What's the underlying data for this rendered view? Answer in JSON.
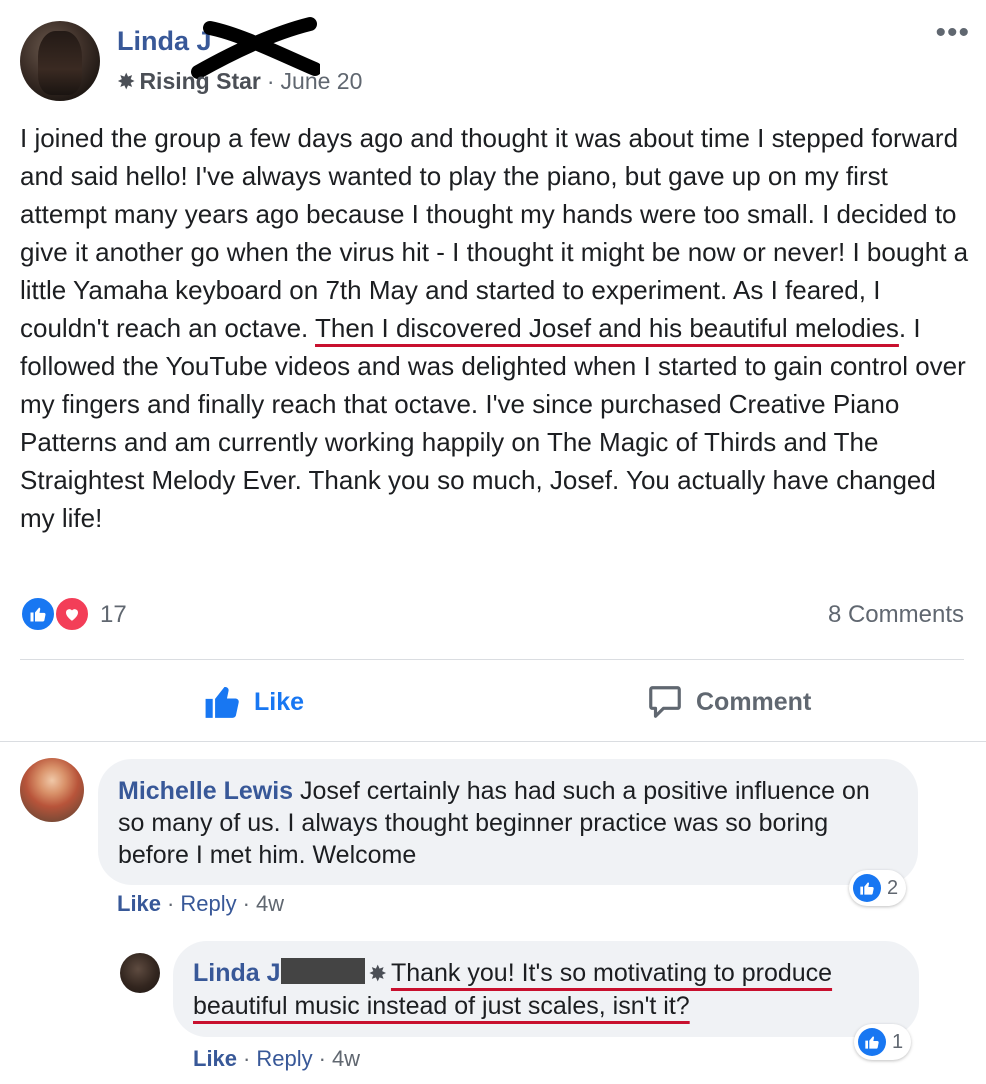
{
  "post": {
    "author": "Linda J",
    "badge": "Rising Star",
    "date": "June 20",
    "more_label": "•••",
    "body_before": "I joined the group a few days ago and thought it was about time I stepped forward and said hello! I've always wanted to play the piano, but gave up on my first attempt many years ago because I thought my hands were too small. I decided to give it another go when the virus hit - I thought it might be now or never! I bought a little Yamaha keyboard on 7th May and started to experiment. As I feared, I couldn't reach an octave. ",
    "body_highlight": "Then I discovered Josef and his beautiful melodies",
    "body_after": ". I followed the YouTube videos and was delighted when I started to gain control over my fingers and finally reach that octave. I've since purchased Creative Piano Patterns and am currently working happily on The Magic of Thirds and The Straightest Melody Ever. Thank you so much, Josef. You actually have changed my life!",
    "reaction_count": "17",
    "comments_count": "8 Comments"
  },
  "actions": {
    "like_label": "Like",
    "comment_label": "Comment"
  },
  "comments": [
    {
      "name": "Michelle Lewis",
      "text": "Josef certainly has had such a positive influence on so many of us. I always thought beginner practice was so boring before I met him. Welcome",
      "like_label": "Like",
      "reply_label": "Reply",
      "age": "4w",
      "reactions": "2"
    },
    {
      "name": "Linda J",
      "text_highlight": "Thank you! It's so motivating to produce beautiful music instead of just scales, isn't it?",
      "like_label": "Like",
      "reply_label": "Reply",
      "age": "4w",
      "reactions": "1"
    }
  ],
  "colors": {
    "link_blue": "#385898",
    "fb_blue": "#1877f2",
    "love_red": "#f33e58",
    "underline_red": "#c8102e",
    "bubble_gray": "#f0f2f5"
  },
  "icons": [
    "more-icon",
    "star-badge-icon",
    "like-reaction-icon",
    "love-reaction-icon",
    "thumbs-up-icon",
    "comment-icon"
  ]
}
